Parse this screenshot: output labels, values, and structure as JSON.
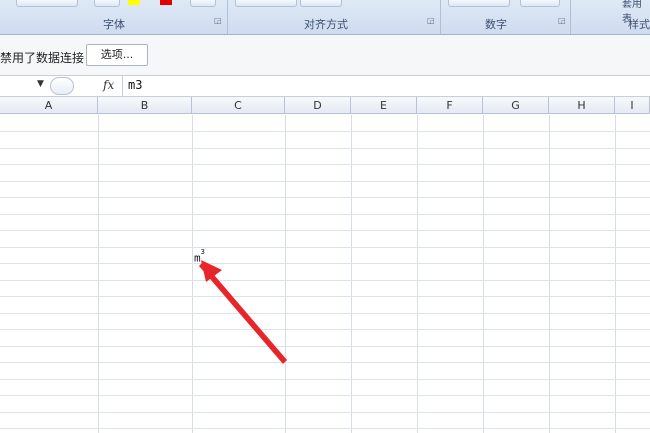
{
  "ribbon": {
    "groups": [
      {
        "label": "字体"
      },
      {
        "label": "对齐方式"
      },
      {
        "label": "数字"
      },
      {
        "label": "样式"
      }
    ],
    "partial_label_top_right": "套用表",
    "colors": {
      "yellow": "#ffff00",
      "red": "#e00000"
    }
  },
  "security_bar": {
    "message": "禁用了数据连接",
    "options_button": "选项..."
  },
  "formula_bar": {
    "fx_label": "fx",
    "content": "m3"
  },
  "grid": {
    "columns": [
      "A",
      "B",
      "C",
      "D",
      "E",
      "F",
      "G",
      "H",
      "I"
    ],
    "cell": {
      "base": "m",
      "superscript": "3"
    }
  }
}
